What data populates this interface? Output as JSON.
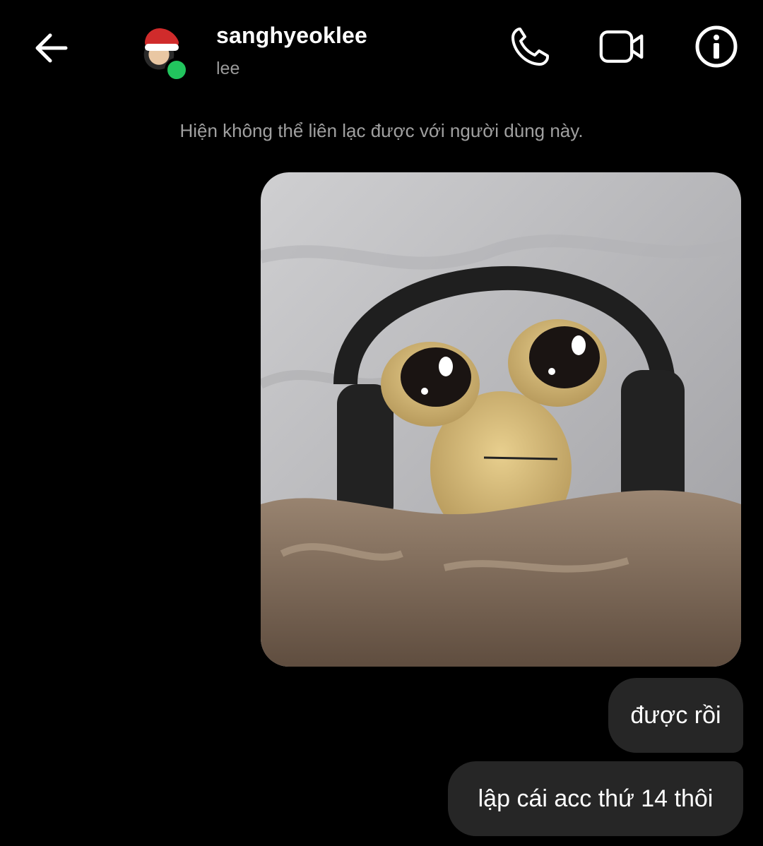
{
  "header": {
    "username": "sanghyeoklee",
    "subname": "lee",
    "online": true,
    "icons": {
      "back": "arrow-left-icon",
      "call": "phone-icon",
      "video": "video-camera-icon",
      "info": "info-icon"
    }
  },
  "notice": "Hiện không thể liên lạc được với người dùng này.",
  "messages": [
    {
      "type": "image",
      "alt_subject": "plush toy wearing headphones under blanket",
      "from": "me"
    },
    {
      "type": "text",
      "text": "được rồi",
      "from": "me"
    },
    {
      "type": "text",
      "text": "lập cái acc thứ 14 thôi",
      "from": "me"
    }
  ],
  "colors": {
    "background": "#000000",
    "bubble": "#262626",
    "online": "#22c55e",
    "muted_text": "#a0a0a0"
  }
}
